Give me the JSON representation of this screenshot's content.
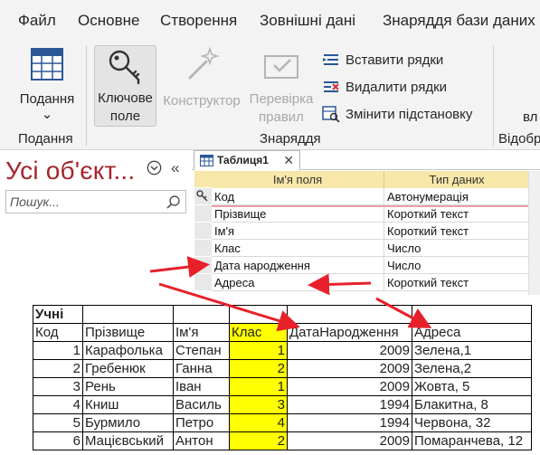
{
  "menu": {
    "tabs": [
      "Файл",
      "Основне",
      "Створення",
      "Зовнішні дані",
      "Знаряддя бази даних"
    ]
  },
  "ribbon": {
    "view_button": {
      "line1": "Подання",
      "chevron": "⌄"
    },
    "key_button": {
      "line1": "Ключове",
      "line2": "поле"
    },
    "designer_button": {
      "label": "Конструктор"
    },
    "validate_button": {
      "line1": "Перевірка",
      "line2": "правил"
    },
    "insert_rows": "Вставити рядки",
    "delete_rows": "Видалити рядки",
    "change_lookup": "Змінити підстановку",
    "group_view": "Подання",
    "group_tools": "Знаряддя",
    "group_show": "Відобра",
    "cut_label": "вл"
  },
  "nav": {
    "title": "Усі об'єкт...",
    "collapse": "«",
    "search_placeholder": "Пошук..."
  },
  "design": {
    "tab_label": "Таблиця1",
    "tab_close": "✕",
    "col_field_name": "Ім'я поля",
    "col_data_type": "Тип даних",
    "fields": [
      {
        "name": "Код",
        "type": "Автонумерація"
      },
      {
        "name": "Прізвище",
        "type": "Короткий текст"
      },
      {
        "name": "Ім'я",
        "type": "Короткий текст"
      },
      {
        "name": "Клас",
        "type": "Число"
      },
      {
        "name": "Дата народження",
        "type": "Число"
      },
      {
        "name": "Адреса",
        "type": "Короткий текст"
      }
    ]
  },
  "students": {
    "caption": "Учні",
    "headers": [
      "Код",
      "Прізвище",
      "Ім'я",
      "Клас",
      "ДатаНародження",
      "Адреса"
    ],
    "rows": [
      [
        "1",
        "Карафолька",
        "Степан",
        "1",
        "2009",
        "Зелена,1"
      ],
      [
        "2",
        "Гребенюк",
        "Ганна",
        "2",
        "2009",
        "Зелена,2"
      ],
      [
        "3",
        "Рень",
        "Іван",
        "1",
        "2009",
        "Жовта, 5"
      ],
      [
        "4",
        "Книш",
        "Василь",
        "3",
        "1994",
        "Блакитна, 8"
      ],
      [
        "5",
        "Бурмило",
        "Петро",
        "4",
        "1994",
        "Червона, 32"
      ],
      [
        "6",
        "Мацієвський",
        "Антон",
        "2",
        "2009",
        "Помаранчева, 12"
      ]
    ]
  },
  "colors": {
    "accent_title": "#a4262c",
    "header_fill": "#f7e7a8",
    "highlight": "#ffff00",
    "arrow": "#e8202a"
  }
}
